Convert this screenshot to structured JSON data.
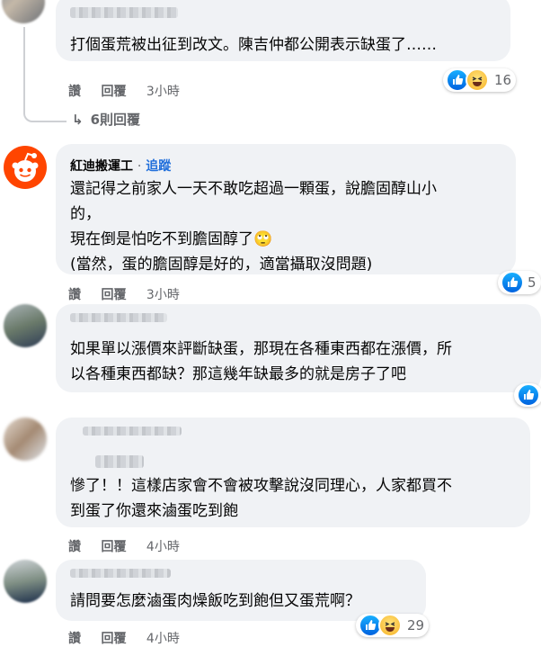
{
  "comments": [
    {
      "author": "",
      "lines": [
        "打個蛋荒被出征到改文。陳吉仲都公開表示缺蛋了……"
      ],
      "actions": {
        "like": "讚",
        "reply": "回覆",
        "time": "3小時"
      },
      "reaction_count": "16",
      "replies_label": "6則回覆"
    },
    {
      "author": "紅迪搬運工",
      "dot": "·",
      "follow": "追蹤",
      "lines": [
        "還記得之前家人一天不敢吃超過一顆蛋，說膽固醇山小",
        "的，",
        "現在倒是怕吃不到膽固醇了🙄",
        "(當然，蛋的膽固醇是好的，適當攝取沒問題)"
      ],
      "actions": {
        "like": "讚",
        "reply": "回覆",
        "time": "3小時"
      },
      "reaction_count": "5"
    },
    {
      "author": "",
      "lines": [
        "如果單以漲價來評斷缺蛋，那現在各種東西都在漲價，所",
        "以各種東西都缺？那這幾年缺最多的就是房子了吧"
      ],
      "actions": {
        "like": "",
        "reply": "",
        "time": ""
      },
      "reaction_count": ""
    },
    {
      "author": "",
      "lines": [
        "慘了！！這樣店家會不會被攻擊說沒同理心，人家都買不",
        "到蛋了你還來滷蛋吃到飽"
      ],
      "actions": {
        "like": "讚",
        "reply": "回覆",
        "time": "4小時"
      },
      "reaction_count": ""
    },
    {
      "author": "",
      "lines": [
        "請問要怎麼滷蛋肉燥飯吃到飽但又蛋荒啊？"
      ],
      "actions": {
        "like": "讚",
        "reply": "回覆",
        "time": "4小時"
      },
      "reaction_count": "29"
    }
  ],
  "colors": {
    "bubble": "#f0f2f5",
    "link": "#216fdb",
    "meta": "#65676b",
    "like": "#1877f2",
    "reddit": "#ff4500"
  }
}
